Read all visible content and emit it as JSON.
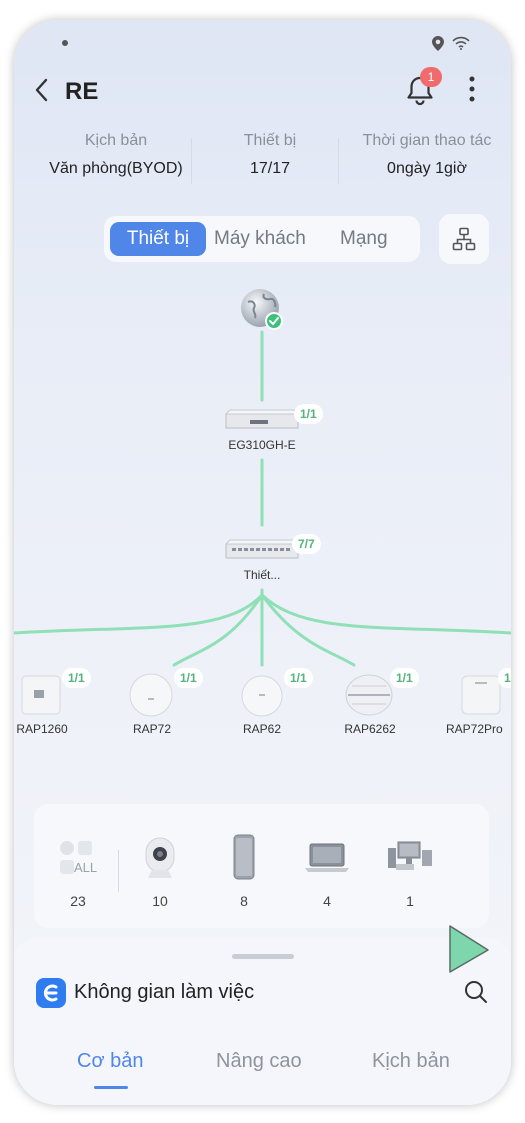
{
  "header": {
    "title": "RE",
    "notification_count": "1"
  },
  "info": {
    "scenario_label": "Kịch bản",
    "scenario_value": "Văn phòng(BYOD)",
    "device_label": "Thiết bị",
    "device_value": "17/17",
    "time_label": "Thời gian thao tác",
    "time_value": "0ngày 1giờ"
  },
  "segments": {
    "device": "Thiết bị",
    "client": "Máy khách",
    "network": "Mạng"
  },
  "topology": {
    "gateway": {
      "label": "EG310GH-E",
      "status": "1/1"
    },
    "switch": {
      "label": "Thiết...",
      "status": "7/7"
    },
    "aps": [
      {
        "label": "RAP1260",
        "status": "1/1"
      },
      {
        "label": "RAP72",
        "status": "1/1"
      },
      {
        "label": "RAP62",
        "status": "1/1"
      },
      {
        "label": "RAP6262",
        "status": "1/1"
      },
      {
        "label": "RAP72Pro",
        "status": "1"
      }
    ]
  },
  "clients": {
    "all_label": "ALL",
    "all_count": "23",
    "camera_count": "10",
    "phone_count": "8",
    "laptop_count": "4",
    "other_count": "1"
  },
  "sheet": {
    "workspace_title": "Không gian làm việc",
    "tabs": [
      "Cơ bản",
      "Nâng cao",
      "Kịch bản"
    ]
  },
  "colors": {
    "accent": "#4f86e8",
    "online_green": "#53b47d",
    "badge_red": "#f06b6b"
  }
}
